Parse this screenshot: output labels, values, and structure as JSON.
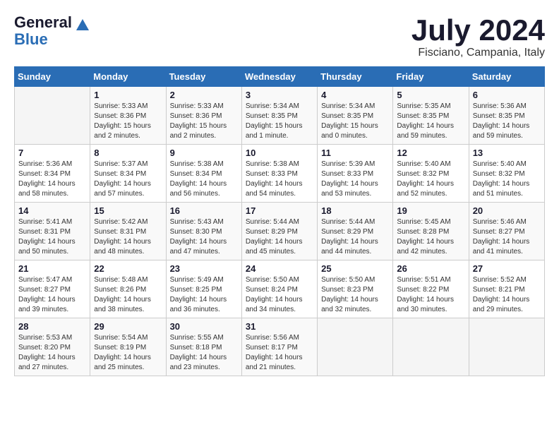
{
  "logo": {
    "general": "General",
    "blue": "Blue"
  },
  "title": {
    "month_year": "July 2024",
    "location": "Fisciano, Campania, Italy"
  },
  "headers": [
    "Sunday",
    "Monday",
    "Tuesday",
    "Wednesday",
    "Thursday",
    "Friday",
    "Saturday"
  ],
  "weeks": [
    [
      {
        "day": "",
        "sunrise": "",
        "sunset": "",
        "daylight": ""
      },
      {
        "day": "1",
        "sunrise": "Sunrise: 5:33 AM",
        "sunset": "Sunset: 8:36 PM",
        "daylight": "Daylight: 15 hours and 2 minutes."
      },
      {
        "day": "2",
        "sunrise": "Sunrise: 5:33 AM",
        "sunset": "Sunset: 8:36 PM",
        "daylight": "Daylight: 15 hours and 2 minutes."
      },
      {
        "day": "3",
        "sunrise": "Sunrise: 5:34 AM",
        "sunset": "Sunset: 8:35 PM",
        "daylight": "Daylight: 15 hours and 1 minute."
      },
      {
        "day": "4",
        "sunrise": "Sunrise: 5:34 AM",
        "sunset": "Sunset: 8:35 PM",
        "daylight": "Daylight: 15 hours and 0 minutes."
      },
      {
        "day": "5",
        "sunrise": "Sunrise: 5:35 AM",
        "sunset": "Sunset: 8:35 PM",
        "daylight": "Daylight: 14 hours and 59 minutes."
      },
      {
        "day": "6",
        "sunrise": "Sunrise: 5:36 AM",
        "sunset": "Sunset: 8:35 PM",
        "daylight": "Daylight: 14 hours and 59 minutes."
      }
    ],
    [
      {
        "day": "7",
        "sunrise": "Sunrise: 5:36 AM",
        "sunset": "Sunset: 8:34 PM",
        "daylight": "Daylight: 14 hours and 58 minutes."
      },
      {
        "day": "8",
        "sunrise": "Sunrise: 5:37 AM",
        "sunset": "Sunset: 8:34 PM",
        "daylight": "Daylight: 14 hours and 57 minutes."
      },
      {
        "day": "9",
        "sunrise": "Sunrise: 5:38 AM",
        "sunset": "Sunset: 8:34 PM",
        "daylight": "Daylight: 14 hours and 56 minutes."
      },
      {
        "day": "10",
        "sunrise": "Sunrise: 5:38 AM",
        "sunset": "Sunset: 8:33 PM",
        "daylight": "Daylight: 14 hours and 54 minutes."
      },
      {
        "day": "11",
        "sunrise": "Sunrise: 5:39 AM",
        "sunset": "Sunset: 8:33 PM",
        "daylight": "Daylight: 14 hours and 53 minutes."
      },
      {
        "day": "12",
        "sunrise": "Sunrise: 5:40 AM",
        "sunset": "Sunset: 8:32 PM",
        "daylight": "Daylight: 14 hours and 52 minutes."
      },
      {
        "day": "13",
        "sunrise": "Sunrise: 5:40 AM",
        "sunset": "Sunset: 8:32 PM",
        "daylight": "Daylight: 14 hours and 51 minutes."
      }
    ],
    [
      {
        "day": "14",
        "sunrise": "Sunrise: 5:41 AM",
        "sunset": "Sunset: 8:31 PM",
        "daylight": "Daylight: 14 hours and 50 minutes."
      },
      {
        "day": "15",
        "sunrise": "Sunrise: 5:42 AM",
        "sunset": "Sunset: 8:31 PM",
        "daylight": "Daylight: 14 hours and 48 minutes."
      },
      {
        "day": "16",
        "sunrise": "Sunrise: 5:43 AM",
        "sunset": "Sunset: 8:30 PM",
        "daylight": "Daylight: 14 hours and 47 minutes."
      },
      {
        "day": "17",
        "sunrise": "Sunrise: 5:44 AM",
        "sunset": "Sunset: 8:29 PM",
        "daylight": "Daylight: 14 hours and 45 minutes."
      },
      {
        "day": "18",
        "sunrise": "Sunrise: 5:44 AM",
        "sunset": "Sunset: 8:29 PM",
        "daylight": "Daylight: 14 hours and 44 minutes."
      },
      {
        "day": "19",
        "sunrise": "Sunrise: 5:45 AM",
        "sunset": "Sunset: 8:28 PM",
        "daylight": "Daylight: 14 hours and 42 minutes."
      },
      {
        "day": "20",
        "sunrise": "Sunrise: 5:46 AM",
        "sunset": "Sunset: 8:27 PM",
        "daylight": "Daylight: 14 hours and 41 minutes."
      }
    ],
    [
      {
        "day": "21",
        "sunrise": "Sunrise: 5:47 AM",
        "sunset": "Sunset: 8:27 PM",
        "daylight": "Daylight: 14 hours and 39 minutes."
      },
      {
        "day": "22",
        "sunrise": "Sunrise: 5:48 AM",
        "sunset": "Sunset: 8:26 PM",
        "daylight": "Daylight: 14 hours and 38 minutes."
      },
      {
        "day": "23",
        "sunrise": "Sunrise: 5:49 AM",
        "sunset": "Sunset: 8:25 PM",
        "daylight": "Daylight: 14 hours and 36 minutes."
      },
      {
        "day": "24",
        "sunrise": "Sunrise: 5:50 AM",
        "sunset": "Sunset: 8:24 PM",
        "daylight": "Daylight: 14 hours and 34 minutes."
      },
      {
        "day": "25",
        "sunrise": "Sunrise: 5:50 AM",
        "sunset": "Sunset: 8:23 PM",
        "daylight": "Daylight: 14 hours and 32 minutes."
      },
      {
        "day": "26",
        "sunrise": "Sunrise: 5:51 AM",
        "sunset": "Sunset: 8:22 PM",
        "daylight": "Daylight: 14 hours and 30 minutes."
      },
      {
        "day": "27",
        "sunrise": "Sunrise: 5:52 AM",
        "sunset": "Sunset: 8:21 PM",
        "daylight": "Daylight: 14 hours and 29 minutes."
      }
    ],
    [
      {
        "day": "28",
        "sunrise": "Sunrise: 5:53 AM",
        "sunset": "Sunset: 8:20 PM",
        "daylight": "Daylight: 14 hours and 27 minutes."
      },
      {
        "day": "29",
        "sunrise": "Sunrise: 5:54 AM",
        "sunset": "Sunset: 8:19 PM",
        "daylight": "Daylight: 14 hours and 25 minutes."
      },
      {
        "day": "30",
        "sunrise": "Sunrise: 5:55 AM",
        "sunset": "Sunset: 8:18 PM",
        "daylight": "Daylight: 14 hours and 23 minutes."
      },
      {
        "day": "31",
        "sunrise": "Sunrise: 5:56 AM",
        "sunset": "Sunset: 8:17 PM",
        "daylight": "Daylight: 14 hours and 21 minutes."
      },
      {
        "day": "",
        "sunrise": "",
        "sunset": "",
        "daylight": ""
      },
      {
        "day": "",
        "sunrise": "",
        "sunset": "",
        "daylight": ""
      },
      {
        "day": "",
        "sunrise": "",
        "sunset": "",
        "daylight": ""
      }
    ]
  ]
}
